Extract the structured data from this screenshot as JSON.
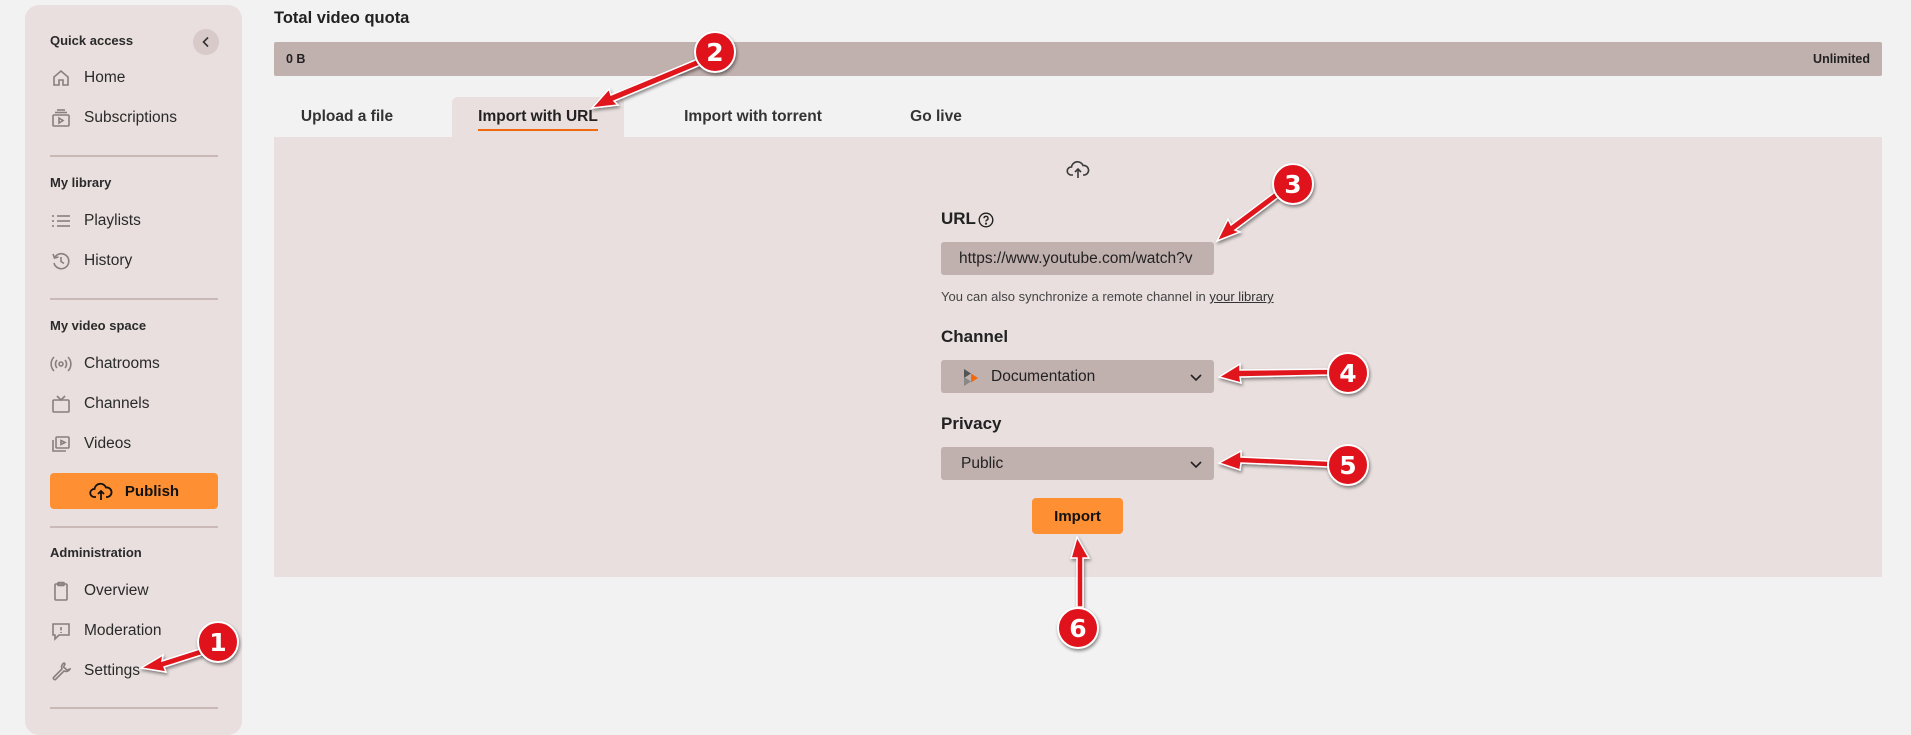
{
  "sidebar": {
    "sections": [
      {
        "heading": "Quick access",
        "items": [
          {
            "label": "Home",
            "icon": "home-icon"
          },
          {
            "label": "Subscriptions",
            "icon": "subscriptions-icon"
          }
        ]
      },
      {
        "heading": "My library",
        "items": [
          {
            "label": "Playlists",
            "icon": "playlist-icon"
          },
          {
            "label": "History",
            "icon": "history-icon"
          }
        ]
      },
      {
        "heading": "My video space",
        "items": [
          {
            "label": "Chatrooms",
            "icon": "broadcast-icon"
          },
          {
            "label": "Channels",
            "icon": "tv-icon"
          },
          {
            "label": "Videos",
            "icon": "videos-icon"
          }
        ]
      },
      {
        "heading": "Administration",
        "items": [
          {
            "label": "Overview",
            "icon": "clipboard-icon"
          },
          {
            "label": "Moderation",
            "icon": "flag-message-icon"
          },
          {
            "label": "Settings",
            "icon": "wrench-icon"
          }
        ]
      }
    ],
    "publish_label": "Publish"
  },
  "quota": {
    "title": "Total video quota",
    "used": "0 B",
    "limit": "Unlimited"
  },
  "tabs": [
    {
      "label": "Upload a file",
      "active": false
    },
    {
      "label": "Import with URL",
      "active": true
    },
    {
      "label": "Import with torrent",
      "active": false
    },
    {
      "label": "Go live",
      "active": false
    }
  ],
  "form": {
    "url_label": "URL",
    "url_value": "https://www.youtube.com/watch?v",
    "hint_text": "You can also synchronize a remote channel in ",
    "hint_link": "your library",
    "channel_label": "Channel",
    "channel_value": "Documentation",
    "privacy_label": "Privacy",
    "privacy_value": "Public",
    "import_label": "Import"
  },
  "annotations": [
    "1",
    "2",
    "3",
    "4",
    "5",
    "6"
  ],
  "colors": {
    "accent": "#fe8f32",
    "tab_underline": "#f1680d",
    "sidebar_bg": "#e8dfde",
    "field_bg": "#c0b0ae",
    "annotation_red": "#e0121b"
  }
}
